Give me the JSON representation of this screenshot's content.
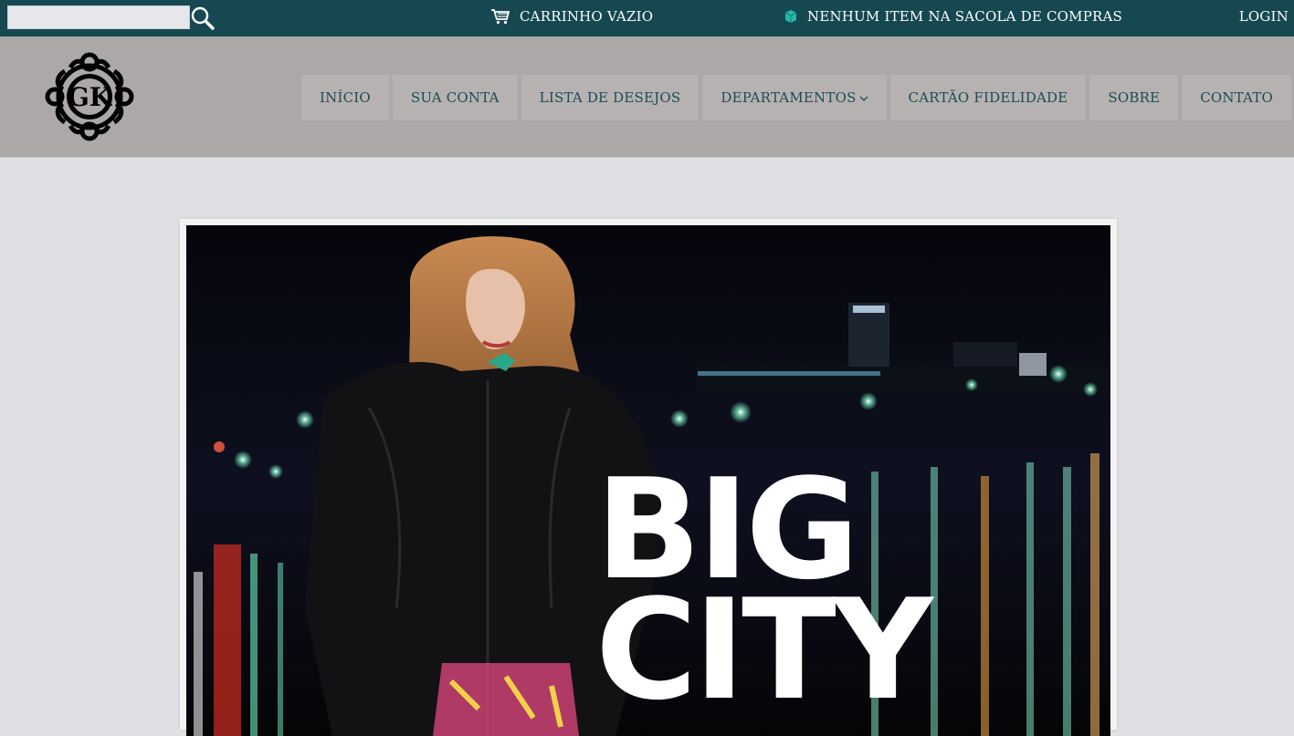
{
  "topbar": {
    "search": {
      "value": "",
      "placeholder": ""
    },
    "cart_label": "CARRINHO VAZIO",
    "bag_label": "NENHUM ITEM NA SACOLA DE COMPRAS",
    "login_label": "LOGIN"
  },
  "header": {
    "logo_text": "GK",
    "nav": [
      {
        "label": "INÍCIO"
      },
      {
        "label": "SUA CONTA"
      },
      {
        "label": "LISTA DE DESEJOS"
      },
      {
        "label": "DEPARTAMENTOS"
      },
      {
        "label": "CARTÃO FIDELIDADE"
      },
      {
        "label": "SOBRE"
      },
      {
        "label": "CONTATO"
      }
    ]
  },
  "hero": {
    "line1": "BIG",
    "line2": "CITY"
  },
  "colors": {
    "topbar_bg": "#164852",
    "header_bg": "#aca8a8",
    "nav_text": "#1e4a55",
    "page_bg": "#dfe0e4"
  },
  "icons": {
    "search": "magnifier-icon",
    "cart": "shopping-cart-icon",
    "bag": "shopping-bag-icon",
    "dropdown": "chevron-down-icon"
  }
}
